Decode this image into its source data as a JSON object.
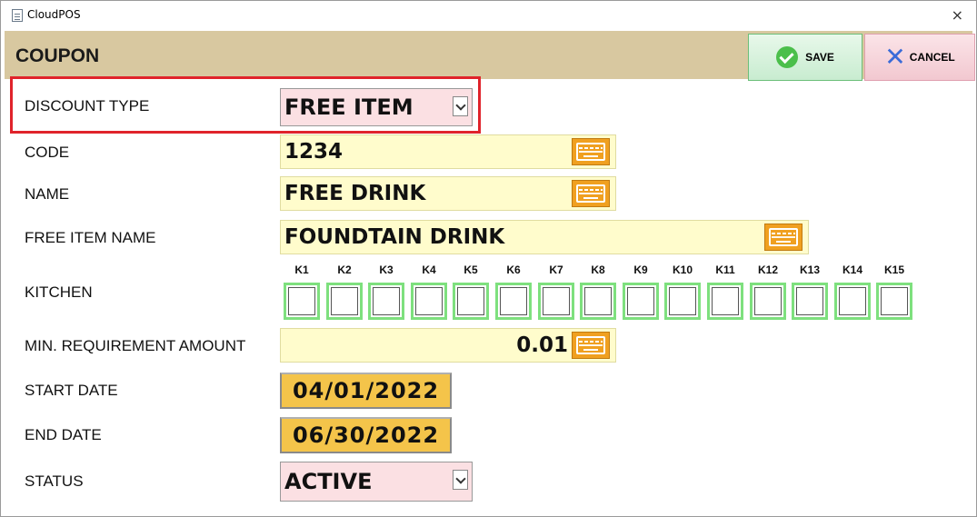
{
  "window": {
    "title": "CloudPOS",
    "close_glyph": "×"
  },
  "header": {
    "title": "COUPON"
  },
  "toolbar": {
    "save_label": "SAVE",
    "cancel_label": "CANCEL"
  },
  "form": {
    "discount_type": {
      "label": "DISCOUNT TYPE",
      "value": "FREE ITEM"
    },
    "code": {
      "label": "CODE",
      "value": "1234"
    },
    "name": {
      "label": "NAME",
      "value": "FREE DRINK"
    },
    "free_item_name": {
      "label": "FREE ITEM NAME",
      "value": "FOUNDTAIN DRINK"
    },
    "kitchen": {
      "label": "KITCHEN",
      "stations": [
        "K1",
        "K2",
        "K3",
        "K4",
        "K5",
        "K6",
        "K7",
        "K8",
        "K9",
        "K10",
        "K11",
        "K12",
        "K13",
        "K14",
        "K15"
      ],
      "checked": [
        false,
        false,
        false,
        false,
        false,
        false,
        false,
        false,
        false,
        false,
        false,
        false,
        false,
        false,
        false
      ]
    },
    "min_requirement_amount": {
      "label": "MIN. REQUIREMENT AMOUNT",
      "value": "0.01"
    },
    "start_date": {
      "label": "START DATE",
      "value": "04/01/2022"
    },
    "end_date": {
      "label": "END DATE",
      "value": "06/30/2022"
    },
    "status": {
      "label": "STATUS",
      "value": "ACTIVE"
    }
  },
  "colors": {
    "header_bg": "#d8c8a0",
    "select_bg": "#fbe0e3",
    "text_field_bg": "#fffccc",
    "keyboard_button": "#f0a020",
    "date_bg": "#f4c44a",
    "checkbox_border": "#7ee07e",
    "highlight": "#e0232b"
  },
  "icons": {
    "save": "check-circle-icon",
    "cancel": "x-icon",
    "keyboard": "keyboard-icon",
    "dropdown": "chevron-down-icon"
  }
}
